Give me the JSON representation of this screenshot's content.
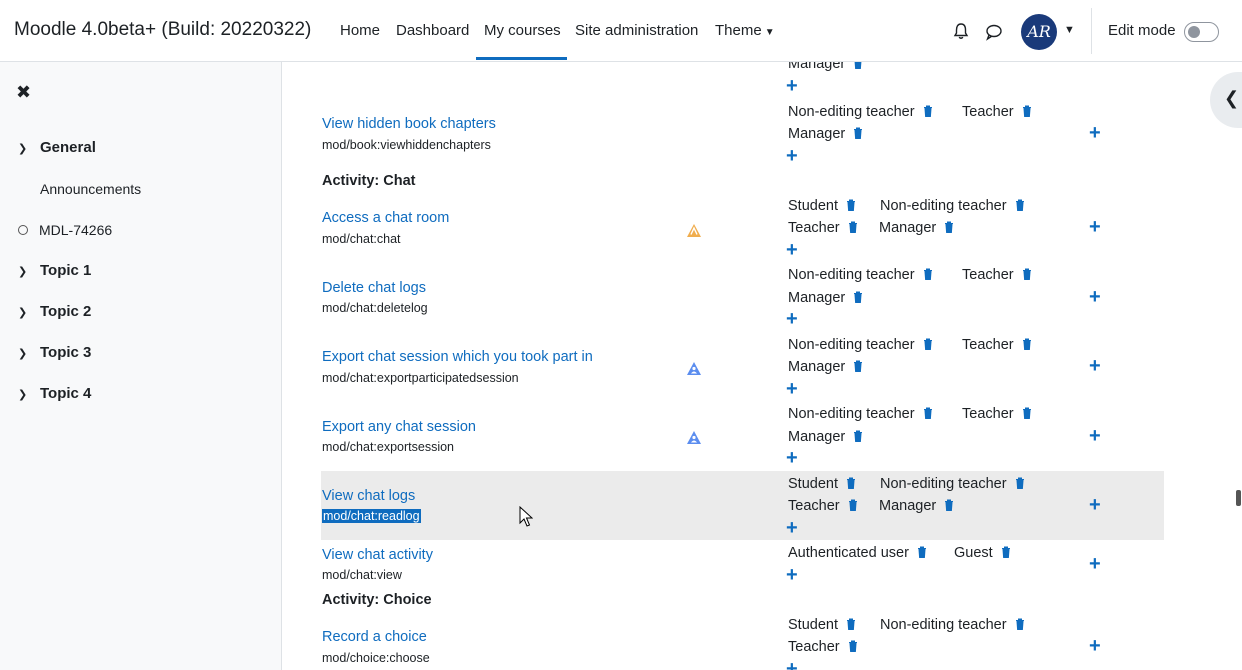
{
  "navbar": {
    "brand": "Moodle 4.0beta+ (Build: 20220322)",
    "items": [
      {
        "label": "Home",
        "active": false
      },
      {
        "label": "Dashboard",
        "active": false
      },
      {
        "label": "My courses",
        "active": true
      },
      {
        "label": "Site administration",
        "active": false
      },
      {
        "label": "Theme",
        "active": false
      }
    ],
    "avatar_initials": "AR",
    "edit_mode_label": "Edit mode",
    "edit_mode_on": false
  },
  "drawer": {
    "sections": [
      {
        "label": "General"
      },
      {
        "label": "Announcements"
      },
      {
        "label": "MDL-74266"
      },
      {
        "label": "Topic 1"
      },
      {
        "label": "Topic 2"
      },
      {
        "label": "Topic 3"
      },
      {
        "label": "Topic 4"
      }
    ]
  },
  "capabilities": {
    "top_role": "Manager",
    "rows": [
      {
        "title": "View hidden book chapters",
        "code": "mod/book:viewhiddenchapters",
        "roles": [
          "Non-editing teacher",
          "Teacher",
          "Manager"
        ]
      },
      {
        "heading": "Activity: Chat"
      },
      {
        "title": "Access a chat room",
        "code": "mod/chat:chat",
        "roles": [
          "Student",
          "Non-editing teacher",
          "Teacher",
          "Manager"
        ],
        "risk": "xss"
      },
      {
        "title": "Delete chat logs",
        "code": "mod/chat:deletelog",
        "roles": [
          "Non-editing teacher",
          "Teacher",
          "Manager"
        ]
      },
      {
        "title": "Export chat session which you took part in",
        "code": "mod/chat:exportparticipatedsession",
        "roles": [
          "Non-editing teacher",
          "Teacher",
          "Manager"
        ],
        "risk": "personal"
      },
      {
        "title": "Export any chat session",
        "code": "mod/chat:exportsession",
        "roles": [
          "Non-editing teacher",
          "Teacher",
          "Manager"
        ],
        "risk": "personal"
      },
      {
        "title": "View chat logs",
        "code": "mod/chat:readlog",
        "roles": [
          "Student",
          "Non-editing teacher",
          "Teacher",
          "Manager"
        ]
      },
      {
        "title": "View chat activity",
        "code": "mod/chat:view",
        "roles": [
          "Authenticated user",
          "Guest"
        ]
      },
      {
        "heading": "Activity: Choice"
      },
      {
        "title": "Record a choice",
        "code": "mod/choice:choose",
        "roles": [
          "Student",
          "Non-editing teacher",
          "Teacher"
        ]
      }
    ]
  },
  "colors": {
    "accent": "#0f6cbf",
    "risk_xss": "#f0ad4e",
    "risk_personal": "#5b8def"
  }
}
